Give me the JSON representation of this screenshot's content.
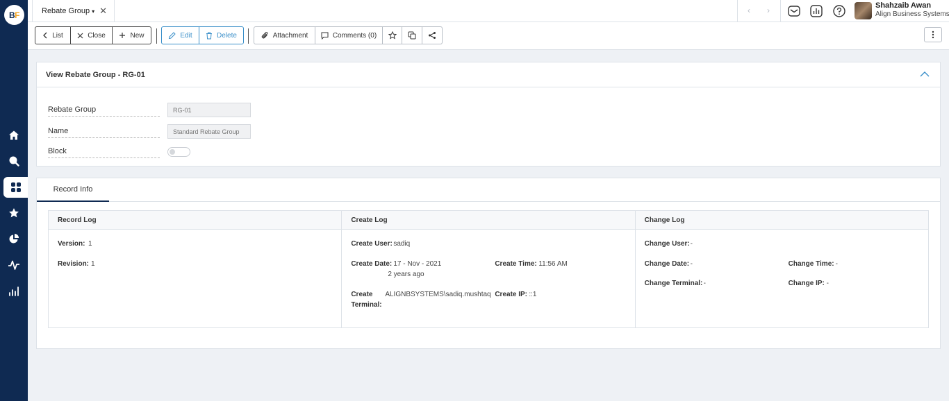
{
  "app": {
    "logo_text_b": "B",
    "logo_text_f": "F"
  },
  "tab": {
    "title": "Rebate Group",
    "caret": "▾",
    "close": "✕"
  },
  "nav": {
    "prev": "‹",
    "next": "›"
  },
  "user": {
    "name": "Shahzaib Awan",
    "company": "Align Business Systems"
  },
  "toolbar": {
    "list": "List",
    "close": "Close",
    "new": "New",
    "edit": "Edit",
    "delete": "Delete",
    "attachment": "Attachment",
    "comments": "Comments (0)"
  },
  "panel": {
    "title": "View Rebate Group - RG-01",
    "fields": {
      "rebate_group_label": "Rebate Group",
      "rebate_group_value": "RG-01",
      "name_label": "Name",
      "name_value": "Standard Rebate Group",
      "block_label": "Block"
    },
    "block_enabled": false
  },
  "record_info": {
    "tab_label": "Record Info",
    "record_log": {
      "title": "Record Log",
      "version_label": "Version:",
      "version": "1",
      "revision_label": "Revision:",
      "revision": "1"
    },
    "create_log": {
      "title": "Create Log",
      "user_label": "Create User:",
      "user": "sadiq",
      "date_label": "Create Date:",
      "date": "17 - Nov - 2021",
      "date_relative": "2 years ago",
      "time_label": "Create Time:",
      "time": "11:56 AM",
      "terminal_label_1": "Create",
      "terminal_label_2": "Terminal:",
      "terminal": "ALIGNBSYSTEMS\\sadiq.mushtaq",
      "ip_label": "Create IP:",
      "ip": "::1"
    },
    "change_log": {
      "title": "Change Log",
      "user_label": "Change User:",
      "user": "-",
      "date_label": "Change Date:",
      "date": "-",
      "time_label": "Change Time:",
      "time": "-",
      "terminal_label": "Change Terminal:",
      "terminal": "-",
      "ip_label": "Change IP:",
      "ip": "-"
    }
  },
  "colors": {
    "sidebar": "#0f2a52",
    "accent_blue": "#3a8fc9",
    "logo_orange": "#f5a623"
  },
  "icons": [
    "home-icon",
    "search-icon",
    "apps-icon",
    "star-icon",
    "pie-chart-icon",
    "activity-icon",
    "bar-chart-icon",
    "mail-icon",
    "report-icon",
    "help-icon",
    "chevron-up-icon",
    "more-vertical-icon"
  ]
}
